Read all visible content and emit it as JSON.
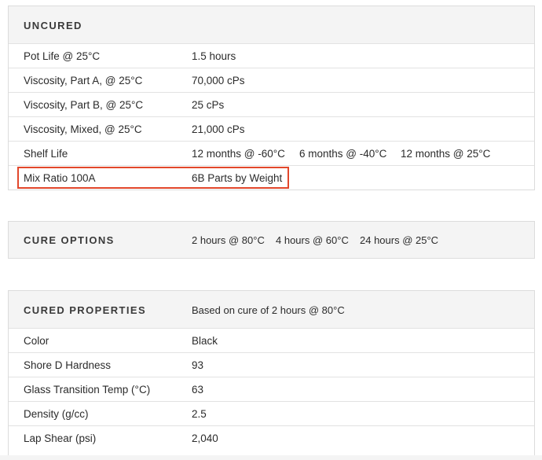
{
  "uncured": {
    "title": "UNCURED",
    "rows": [
      {
        "label": "Pot Life @ 25°C",
        "value": "1.5 hours"
      },
      {
        "label": "Viscosity, Part A, @ 25°C",
        "value": "70,000 cPs"
      },
      {
        "label": "Viscosity, Part B, @ 25°C",
        "value": "25 cPs"
      },
      {
        "label": "Viscosity, Mixed, @ 25°C",
        "value": "21,000 cPs"
      }
    ],
    "shelf_life": {
      "label": "Shelf Life",
      "values": [
        "12 months @ -60°C",
        "6 months @ -40°C",
        "12 months @ 25°C"
      ]
    },
    "mix_ratio": {
      "label": "Mix Ratio 100A",
      "value": "6B Parts by Weight"
    },
    "highlight_color": "#e2472b"
  },
  "cure_options": {
    "title": "CURE OPTIONS",
    "values": [
      "2 hours @ 80°C",
      "4 hours @ 60°C",
      "24 hours @ 25°C"
    ]
  },
  "cured_properties": {
    "title": "CURED PROPERTIES",
    "note": "Based on cure of 2 hours @ 80°C",
    "rows": [
      {
        "label": "Color",
        "value": "Black"
      },
      {
        "label": "Shore D Hardness",
        "value": "93"
      },
      {
        "label": "Glass Transition Temp (°C)",
        "value": "63"
      },
      {
        "label": "Density (g/cc)",
        "value": "2.5"
      },
      {
        "label": "Lap Shear (psi)",
        "value": "2,040"
      }
    ]
  }
}
